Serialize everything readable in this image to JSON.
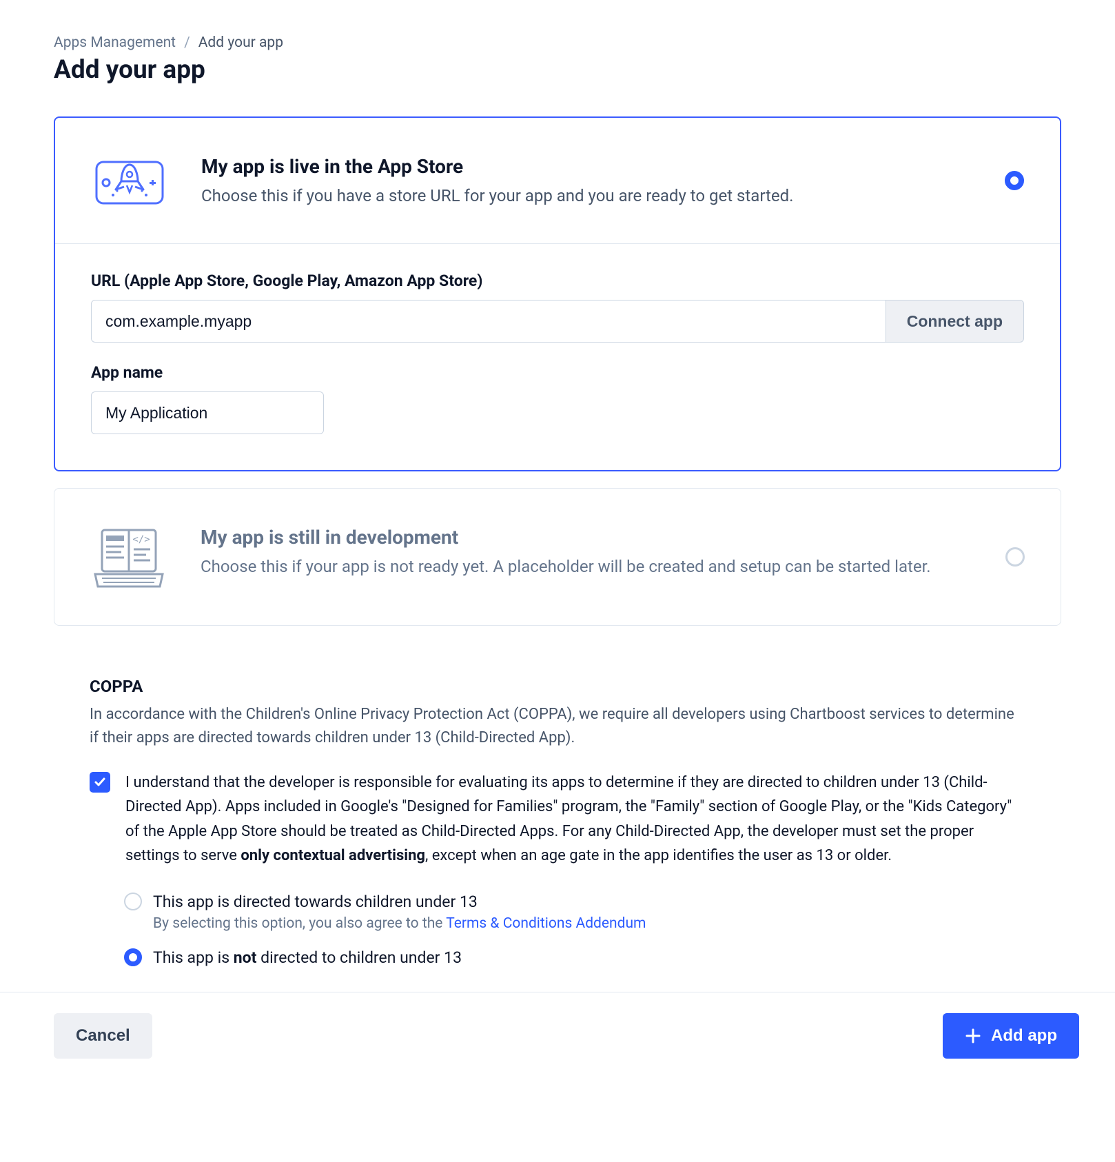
{
  "breadcrumb": {
    "root": "Apps Management",
    "current": "Add your app"
  },
  "page_title": "Add your app",
  "option_live": {
    "title": "My app is live in the App Store",
    "desc": "Choose this if you have a store URL for your app and you are ready to get started.",
    "selected": true
  },
  "option_dev": {
    "title": "My app is still in development",
    "desc": "Choose this if your app is not ready yet. A placeholder will be created and setup can be started later.",
    "selected": false
  },
  "form": {
    "url_label": "URL (Apple App Store, Google Play, Amazon App Store)",
    "url_value": "com.example.myapp",
    "connect_label": "Connect app",
    "appname_label": "App name",
    "appname_value": "My Application"
  },
  "coppa": {
    "heading": "COPPA",
    "intro": "In accordance with the Children's Online Privacy Protection Act (COPPA), we require all developers using Chartboost services to determine if their apps are directed towards children under 13 (Child-Directed App).",
    "ack_pre": "I understand that the developer is responsible for evaluating its apps to determine if they are directed to children under 13 (Child-Directed App). Apps included in Google's \"Designed for Families\" program, the \"Family\" section of Google Play, or the \"Kids Category\" of the Apple App Store should be treated as Child-Directed Apps. For any Child-Directed App, the developer must set the proper settings to serve ",
    "ack_bold": "only contextual advertising",
    "ack_post": ", except when an age gate in the app identifies the user as 13 or older.",
    "radio1_label": "This app is directed towards children under 13",
    "radio1_hint_pre": "By selecting this option, you also agree to the ",
    "radio1_hint_link": "Terms & Conditions Addendum",
    "radio2_pre": "This app is ",
    "radio2_bold": "not",
    "radio2_post": " directed to children under 13"
  },
  "footer": {
    "cancel": "Cancel",
    "add": "Add app"
  }
}
